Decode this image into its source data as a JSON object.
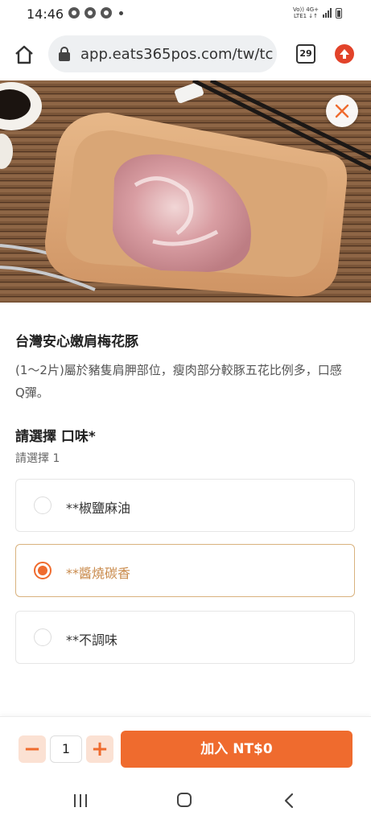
{
  "status_bar": {
    "time": "14:46",
    "network_top": "Vo)) 4G+",
    "network_bottom": "LTE1 ↓↑"
  },
  "browser": {
    "url": "app.eats365pos.com/tw/tc",
    "tab_count": "29"
  },
  "product": {
    "title": "台灣安心嫩肩梅花豚",
    "description": "(1～2片)屬於豬隻肩胛部位，瘦肉部分較豚五花比例多，口感 Q彈。"
  },
  "flavor_section": {
    "title": "請選擇 口味*",
    "subtitle": "請選擇 1",
    "options": [
      {
        "label": "**椒鹽麻油",
        "selected": false
      },
      {
        "label": "**醬燒碳香",
        "selected": true
      },
      {
        "label": "**不調味",
        "selected": false
      }
    ]
  },
  "cart": {
    "quantity": "1",
    "minus": "−",
    "plus": "+",
    "add_label": "加入 NT$0"
  },
  "colors": {
    "accent": "#ef6b2e",
    "selected_text": "#c98a4b",
    "selected_border": "#d9b27e"
  }
}
